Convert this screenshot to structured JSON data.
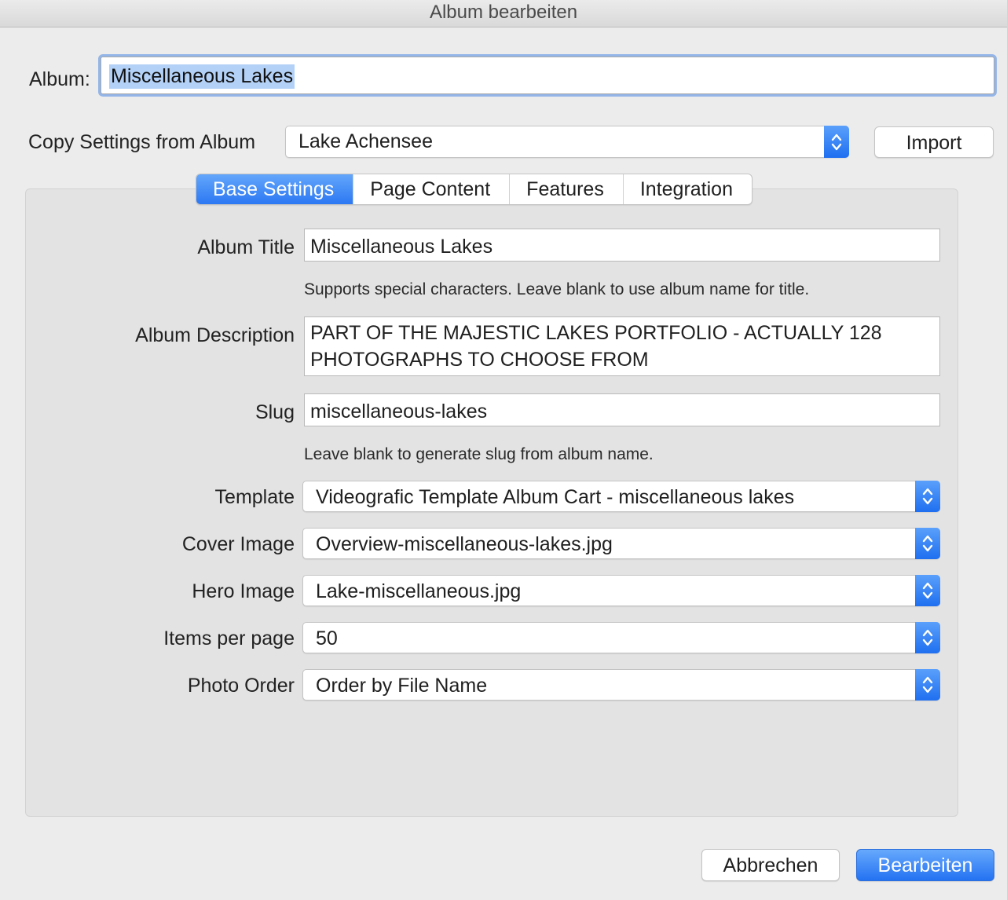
{
  "window": {
    "title": "Album bearbeiten"
  },
  "album": {
    "label": "Album:",
    "value": "Miscellaneous Lakes"
  },
  "copy_settings": {
    "label": "Copy Settings from Album",
    "selected": "Lake Achensee",
    "import_label": "Import"
  },
  "tabs": [
    {
      "label": "Base Settings",
      "active": true
    },
    {
      "label": "Page Content",
      "active": false
    },
    {
      "label": "Features",
      "active": false
    },
    {
      "label": "Integration",
      "active": false
    }
  ],
  "form": {
    "album_title": {
      "label": "Album Title",
      "value": "Miscellaneous Lakes",
      "hint": "Supports special characters.  Leave blank to use album name for title."
    },
    "album_description": {
      "label": "Album Description",
      "value": "PART OF THE MAJESTIC LAKES PORTFOLIO - ACTUALLY 128 PHOTOGRAPHS TO CHOOSE FROM"
    },
    "slug": {
      "label": "Slug",
      "value": "miscellaneous-lakes",
      "hint": "Leave blank to generate slug from album name."
    },
    "template": {
      "label": "Template",
      "selected": "Videografic Template Album Cart - miscellaneous lakes"
    },
    "cover_image": {
      "label": "Cover Image",
      "selected": "Overview-miscellaneous-lakes.jpg"
    },
    "hero_image": {
      "label": "Hero Image",
      "selected": "Lake-miscellaneous.jpg"
    },
    "items_per_page": {
      "label": "Items per page",
      "selected": "50"
    },
    "photo_order": {
      "label": "Photo Order",
      "selected": "Order by File Name"
    }
  },
  "footer": {
    "cancel_label": "Abbrechen",
    "confirm_label": "Bearbeiten"
  },
  "colors": {
    "accent": "#2c78f3",
    "background": "#ececec",
    "panel": "#e3e3e3"
  },
  "icons": {
    "popup_arrows": "chevron-up-down-icon"
  }
}
